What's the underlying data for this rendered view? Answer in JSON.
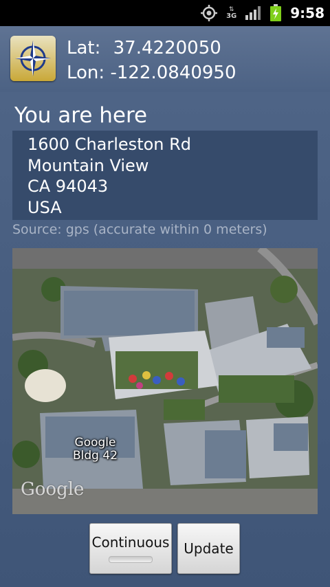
{
  "status_bar": {
    "time": "9:58",
    "network_type": "3G",
    "icons": [
      "gps-icon",
      "data-arrows-icon",
      "signal-icon",
      "battery-charging-icon"
    ]
  },
  "header": {
    "app_icon": "compass-rose-icon",
    "lat_label": "Lat:",
    "lat_value": "37.4220050",
    "lon_label": "Lon:",
    "lon_value": "-122.0840950"
  },
  "location": {
    "title": "You are here",
    "address_lines": [
      "1600 Charleston Rd",
      "Mountain View",
      "CA 94043",
      "USA"
    ],
    "source": "Source: gps (accurate within 0 meters)"
  },
  "map": {
    "label_line1": "Google",
    "label_line2": "Bldg 42",
    "watermark": "Google"
  },
  "buttons": {
    "continuous_label": "Continuous",
    "update_label": "Update"
  }
}
